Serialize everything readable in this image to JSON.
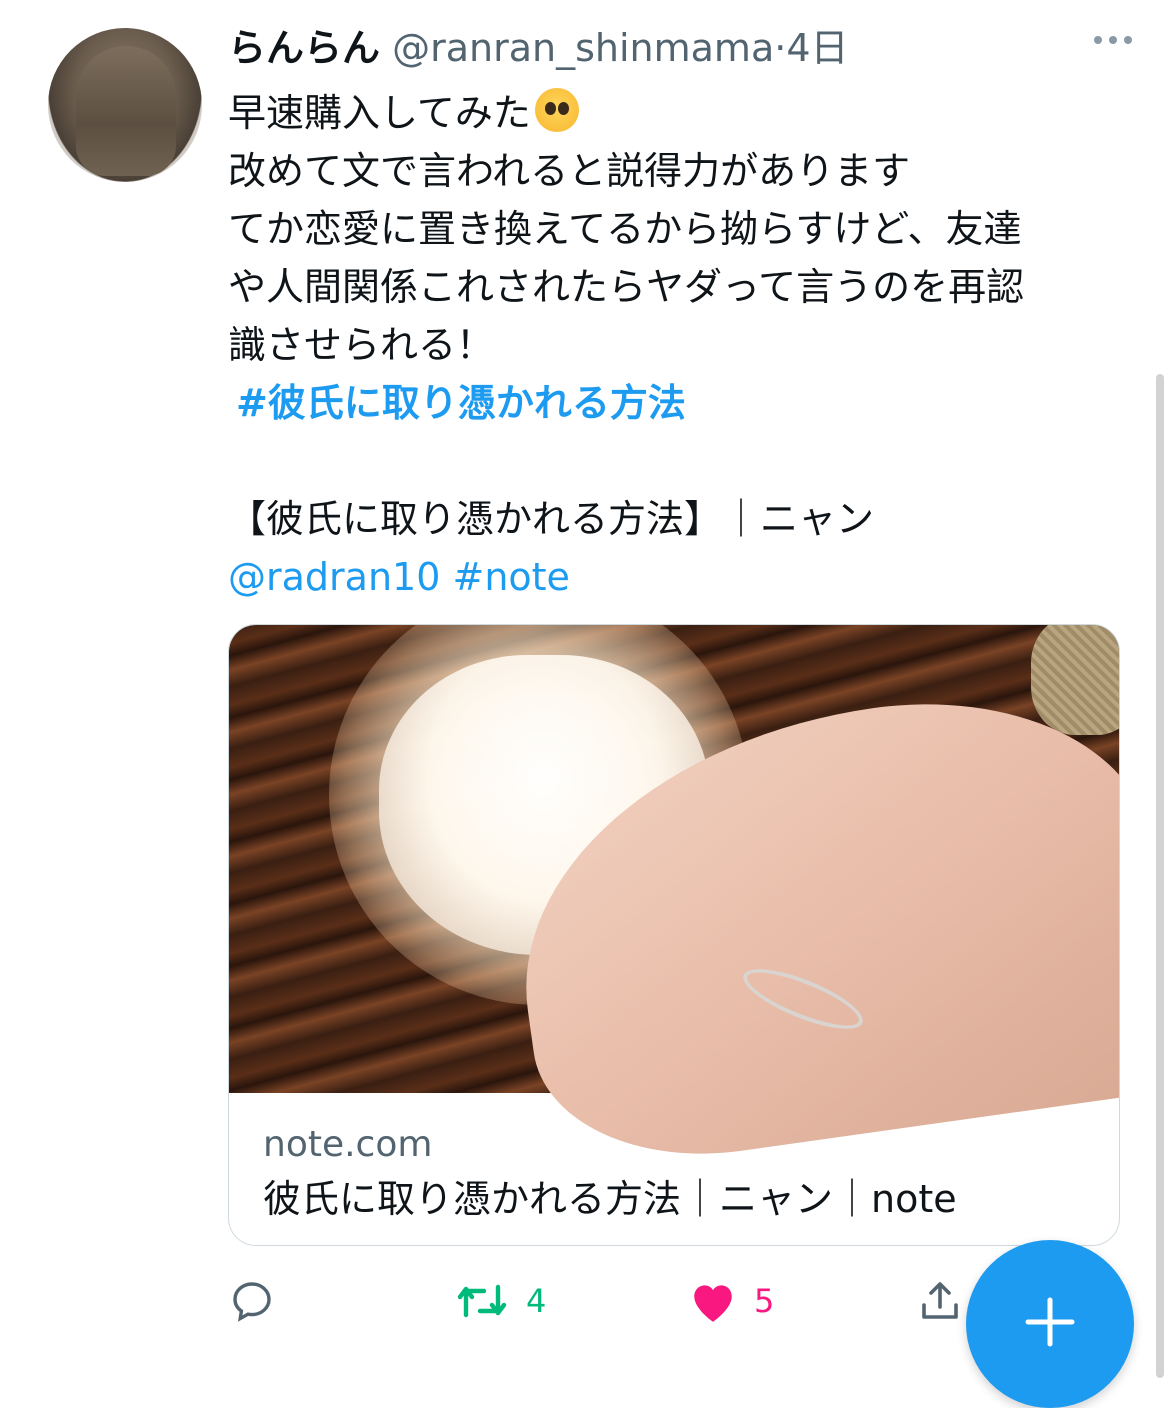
{
  "tweet": {
    "display_name": "らんらん",
    "handle": "@ranran_shinmama",
    "separator": "·",
    "time": "4日",
    "lines": [
      "早速購入してみた",
      "改めて文で言われると説得力があります",
      "てか恋愛に置き換えてるから拗らすけど、友達",
      "や人間関係これされたらヤダって言うのを再認",
      "識させられる！"
    ],
    "hashtag": "#彼氏に取り憑かれる方法",
    "share_title": "【彼氏に取り憑かれる方法】｜ニャン",
    "share_mention": "@radran10",
    "share_hashtag": "#note",
    "emoji": "pleading-face-emoji"
  },
  "card": {
    "domain": "note.com",
    "title": "彼氏に取り憑かれる方法｜ニャン｜note"
  },
  "actions": {
    "retweet_count": "4",
    "like_count": "5"
  },
  "colors": {
    "accent": "#1d9bf0",
    "retweet": "#00ba7c",
    "like": "#f91880",
    "secondary_text": "#536471"
  },
  "icons": [
    "more-icon",
    "reply-icon",
    "retweet-icon",
    "heart-icon",
    "share-icon",
    "compose-plus-icon"
  ]
}
